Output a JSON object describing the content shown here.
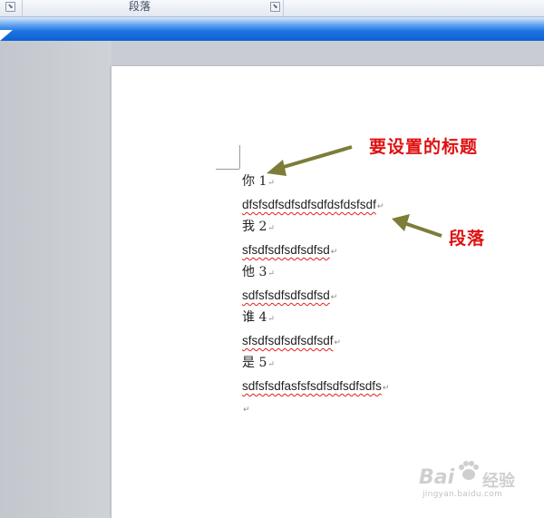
{
  "ribbon": {
    "group_label": "段落"
  },
  "document": {
    "lines": [
      {
        "text": "你 1",
        "kind": "heading"
      },
      {
        "text": "dfsfsdfsdfsdfsdfdsfdsfsdf",
        "kind": "para"
      },
      {
        "text": "我 2",
        "kind": "heading"
      },
      {
        "text": "sfsdfsdfsdfsdfsd",
        "kind": "para"
      },
      {
        "text": "他 3",
        "kind": "heading"
      },
      {
        "text": "sdfsfsdfsdfsdfsd",
        "kind": "para"
      },
      {
        "text": "谁 4",
        "kind": "heading"
      },
      {
        "text": "sfsdfsdfsdfsdfsdf",
        "kind": "para"
      },
      {
        "text": "是 5",
        "kind": "heading"
      },
      {
        "text": "sdfsfsdfasfsfsdfsdfsdfsdfs",
        "kind": "para"
      }
    ],
    "paragraph_mark": "↵"
  },
  "annotations": {
    "title_note": "要设置的标题",
    "para_note": "段落",
    "color": "#e01010",
    "arrow_color": "#7d7d3a"
  },
  "watermark": {
    "brand": "Bai",
    "name": "经验",
    "url": "jingyan.baidu.com"
  }
}
